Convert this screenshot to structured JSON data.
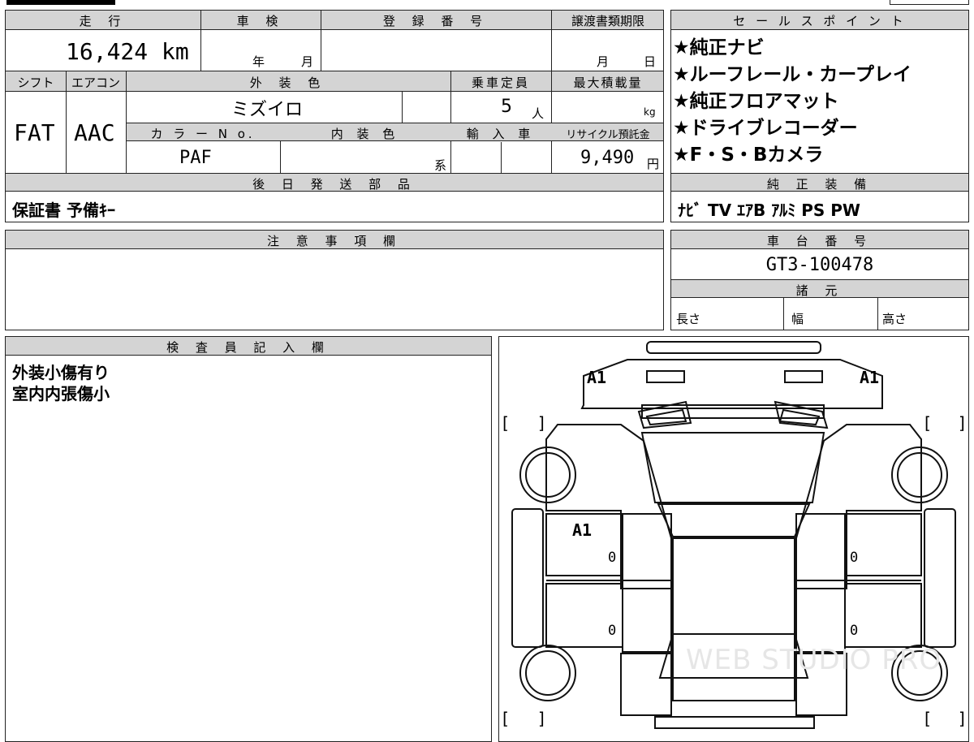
{
  "top": {
    "mileage_header": "走 行",
    "mileage_value": "16,424 km",
    "shaken_header": "車 検",
    "shaken_year_unit": "年",
    "shaken_month_unit": "月",
    "registration_header": "登 録 番 号",
    "transfer_deadline_header": "譲渡書類期限",
    "transfer_month_unit": "月",
    "transfer_day_unit": "日"
  },
  "row2": {
    "shift_header": "シフト",
    "shift_value": "FAT",
    "aircon_header": "エアコン",
    "aircon_value": "AAC",
    "exterior_color_header": "外 装 色",
    "exterior_color_value": "ミズイロ",
    "capacity_header": "乗車定員",
    "capacity_value": "5",
    "capacity_unit": "人",
    "max_load_header": "最大積載量",
    "max_load_unit": "kg",
    "color_no_header": "カ ラ ー N o.",
    "color_no_value": "PAF",
    "interior_color_header": "内 装 色",
    "interior_color_unit": "系",
    "import_header": "輸 入 車",
    "recycle_header": "リサイクル預託金",
    "recycle_value": "9,490",
    "recycle_unit": "円"
  },
  "later_parts": {
    "header": "後 日 発 送 部 品",
    "value": "保証書 予備ｷｰ"
  },
  "notes": {
    "header": "注 意 事 項 欄",
    "value": ""
  },
  "sales_points": {
    "header": "セ ー ル ス ポ イ ン ト",
    "items": [
      "★純正ナビ",
      "★ルーフレール・カープレイ",
      "★純正フロアマット",
      "★ドライブレコーダー",
      "★F・S・Bカメラ"
    ]
  },
  "genuine_equipment": {
    "header": "純 正 装 備",
    "value": "ﾅﾋﾞ TV ｴｱB ｱﾙﾐ PS PW"
  },
  "chassis": {
    "header": "車 台 番 号",
    "value": "GT3-100478"
  },
  "specs": {
    "header": "諸 元",
    "length_label": "長さ",
    "width_label": "幅",
    "height_label": "高さ"
  },
  "inspector": {
    "header": "検 査 員 記 入 欄",
    "lines": [
      "外装小傷有り",
      "室内内張傷小"
    ]
  },
  "diagram": {
    "marks": {
      "front_left": "A1",
      "front_right": "A1",
      "left_front_door": "A1",
      "left_door_1": "0",
      "left_door_2": "0",
      "right_door_1": "0",
      "right_door_2": "0"
    },
    "bracket_open": "[",
    "bracket_close": "]",
    "watermark": "WEB STUDIO PRO"
  }
}
